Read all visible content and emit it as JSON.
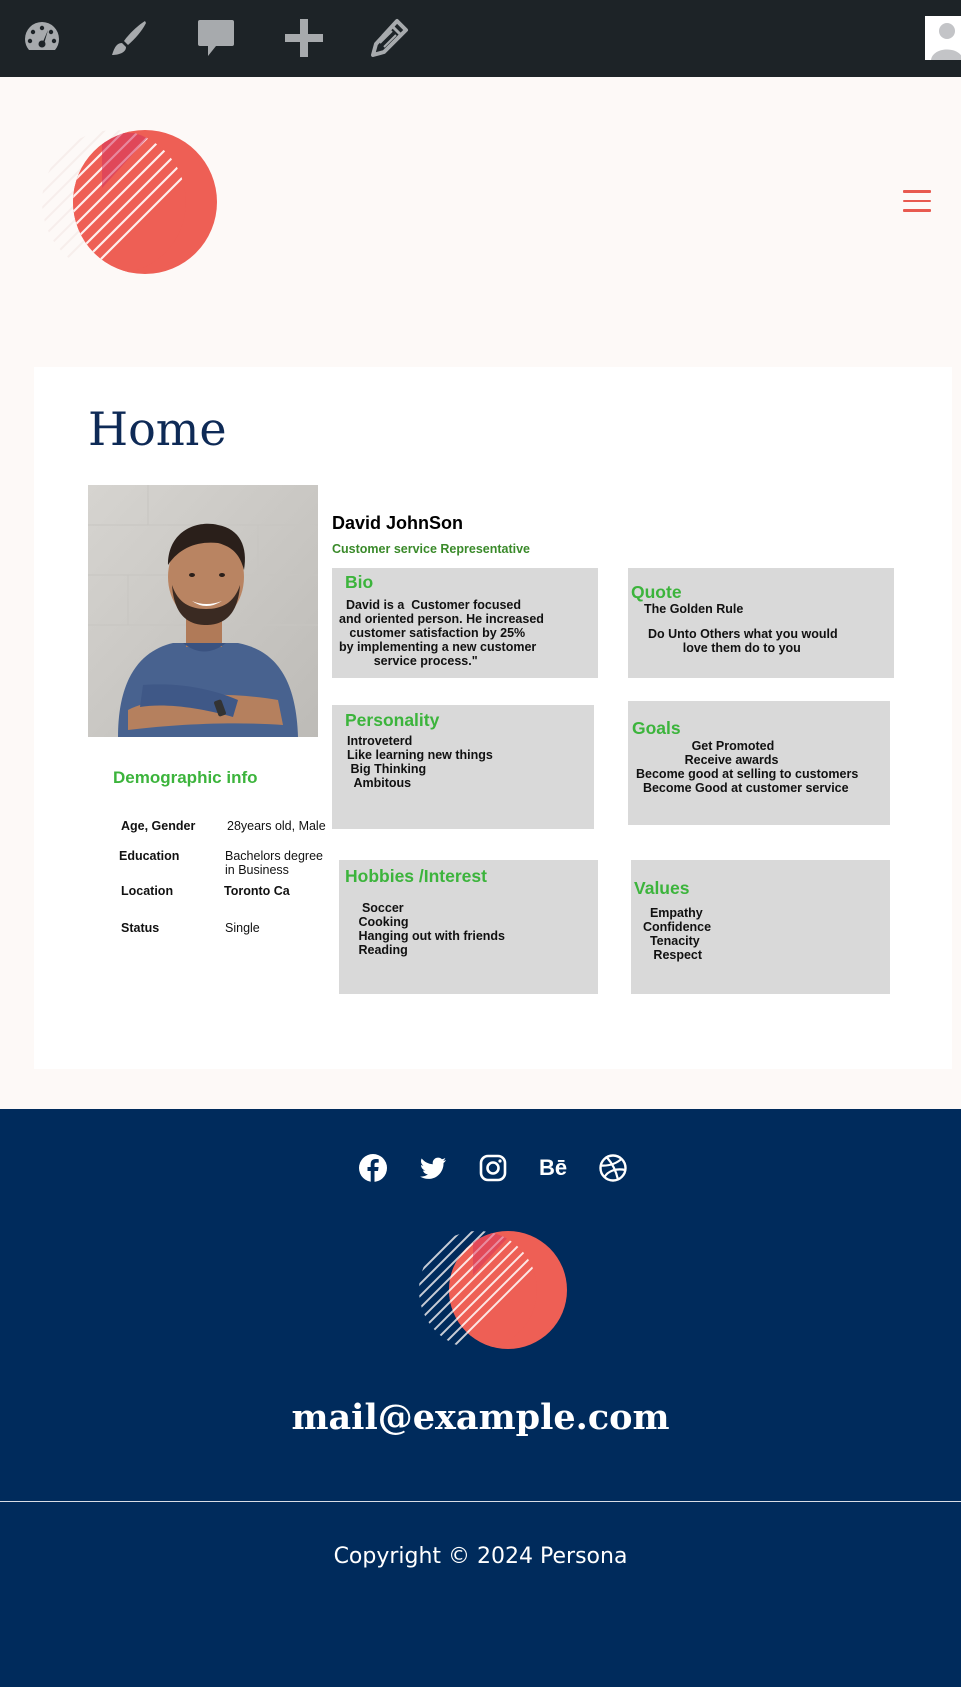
{
  "admin_bar": {
    "icons": [
      "dashboard-icon",
      "brush-icon",
      "comment-icon",
      "plus-icon",
      "pencil-icon",
      "user-avatar"
    ]
  },
  "header": {
    "logo_colors": {
      "primary": "#e85a50",
      "accent": "#d6335c"
    },
    "menu_icon": "hamburger-icon"
  },
  "main": {
    "title": "Home",
    "persona": {
      "name": "David JohnSon",
      "role": "Customer service Representative",
      "bio": {
        "title": "Bio",
        "text": "  David is a  Customer focused\nand oriented person. He increased\n   customer satisfaction by 25%\nby implementing a new customer\n          service process.\""
      },
      "quote": {
        "title": "Quote",
        "line1": "The Golden Rule",
        "line2": "Do Unto Others what you would\n          love them do to you"
      },
      "personality": {
        "title": "Personality",
        "text": "Introveterd\nLike learning new things\n Big Thinking\n  Ambitous"
      },
      "goals": {
        "title": "Goals",
        "text": "                Get Promoted\n              Receive awards\nBecome good at selling to customers\n  Become Good at customer service"
      },
      "hobbies": {
        "title": "Hobbies /Interest",
        "text": "  Soccer\n Cooking\n Hanging out with friends\n Reading"
      },
      "values": {
        "title": "Values",
        "text": "  Empathy\nConfidence\n  Tenacity\n   Respect"
      },
      "demographic": {
        "title": "Demographic info",
        "rows": [
          {
            "label": "Age, Gender",
            "value": "28years old, Male"
          },
          {
            "label": "Education",
            "value": "Bachelors degree\nin Business"
          },
          {
            "label": "Location",
            "value": "Toronto   Ca"
          },
          {
            "label": "Status",
            "value": "Single"
          }
        ]
      },
      "colors": {
        "heading_green": "#3cb43c",
        "role_green": "#3a8a2a",
        "box_gray": "#d9d9d9"
      }
    }
  },
  "footer": {
    "social_icons": [
      "facebook-icon",
      "twitter-icon",
      "instagram-icon",
      "behance-icon",
      "dribbble-icon"
    ],
    "behance_label": "Bē",
    "email": "mail@example.com",
    "copyright": "Copyright © 2024 Persona",
    "background": "#002b5c"
  }
}
